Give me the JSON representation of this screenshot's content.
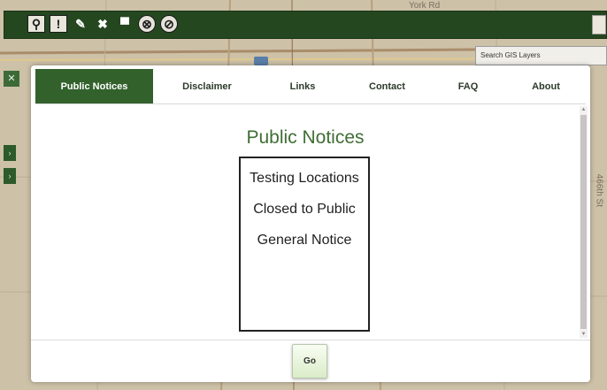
{
  "map": {
    "road_label": "York Rd",
    "street_label": "466th St"
  },
  "toolbar": {
    "tools": [
      {
        "name": "location-pin-icon",
        "glyph": "⚲"
      },
      {
        "name": "exclamation-icon",
        "glyph": "!"
      },
      {
        "name": "pencil-icon",
        "glyph": "✎"
      },
      {
        "name": "cross-tools-icon",
        "glyph": "✖"
      },
      {
        "name": "printer-icon",
        "glyph": "▀"
      },
      {
        "name": "clear-circle-icon",
        "glyph": "⊗"
      },
      {
        "name": "prohibit-icon",
        "glyph": "⊘"
      }
    ]
  },
  "search": {
    "placeholder": "Search GIS Layers"
  },
  "side": {
    "close_glyph": "✕",
    "button_glyph": "›"
  },
  "modal": {
    "tabs": [
      {
        "label": "Public Notices",
        "active": true
      },
      {
        "label": "Disclaimer",
        "active": false
      },
      {
        "label": "Links",
        "active": false
      },
      {
        "label": "Contact",
        "active": false
      },
      {
        "label": "FAQ",
        "active": false
      },
      {
        "label": "About",
        "active": false
      }
    ],
    "title": "Public Notices",
    "notices": [
      "Testing Locations",
      "Closed to Public",
      "General Notice"
    ],
    "go_label": "Go"
  },
  "colors": {
    "toolbar_green": "#24471f",
    "active_tab": "#32612c",
    "title_green": "#3f6e34"
  }
}
